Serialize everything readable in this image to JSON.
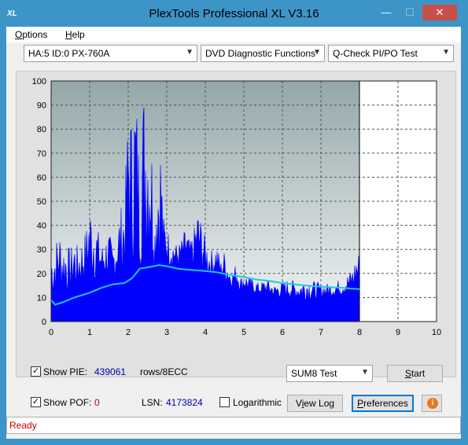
{
  "window": {
    "title": "PlexTools Professional XL V3.16",
    "icon_text": "XL",
    "min_symbol": "—",
    "max_symbol": "☐",
    "close_symbol": "✕",
    "accent": "#3d95c7"
  },
  "menu": {
    "options_first": "O",
    "options_rest": "ptions",
    "help_first": "H",
    "help_rest": "elp"
  },
  "toolbar": {
    "drive": "HA:5 ID:0  PX-760A",
    "function": "DVD Diagnostic Functions",
    "test": "Q-Check PI/PO Test"
  },
  "chart_data": {
    "type": "area",
    "x_ticks": [
      0,
      1,
      2,
      3,
      4,
      5,
      6,
      7,
      8,
      9,
      10
    ],
    "y_ticks": [
      0,
      10,
      20,
      30,
      40,
      50,
      60,
      70,
      80,
      90,
      100
    ],
    "xlim": [
      0,
      10
    ],
    "ylim": [
      0,
      100
    ],
    "grid": true,
    "data_end_x": 8,
    "fill_color": "#0000ff",
    "line_color": "#1ec8e8",
    "pie_envelope": {
      "x": [
        0,
        0.1,
        0.2,
        0.3,
        0.4,
        0.5,
        0.6,
        0.7,
        0.8,
        0.9,
        1.0,
        1.1,
        1.2,
        1.3,
        1.4,
        1.5,
        1.6,
        1.7,
        1.8,
        1.9,
        2.0,
        2.05,
        2.1,
        2.15,
        2.2,
        2.25,
        2.3,
        2.35,
        2.4,
        2.5,
        2.6,
        2.7,
        2.75,
        2.8,
        2.85,
        2.9,
        3.0,
        3.1,
        3.2,
        3.3,
        3.4,
        3.5,
        3.6,
        3.7,
        3.8,
        3.9,
        4.0,
        4.1,
        4.2,
        4.3,
        4.4,
        4.5,
        4.6,
        4.7,
        4.8,
        4.9,
        5.0,
        5.2,
        5.4,
        5.6,
        5.8,
        6.0,
        6.2,
        6.4,
        6.6,
        6.8,
        7.0,
        7.2,
        7.4,
        7.6,
        7.7,
        7.8,
        7.85,
        7.9,
        7.95,
        8.0
      ],
      "y": [
        30,
        32,
        40,
        33,
        33,
        30,
        35,
        31,
        35,
        38,
        50,
        45,
        40,
        32,
        35,
        38,
        30,
        37,
        48,
        50,
        90,
        95,
        80,
        98,
        99,
        85,
        60,
        85,
        100,
        90,
        80,
        40,
        70,
        65,
        80,
        45,
        40,
        35,
        33,
        32,
        35,
        40,
        33,
        38,
        48,
        42,
        35,
        30,
        30,
        33,
        25,
        30,
        22,
        20,
        25,
        18,
        20,
        18,
        16,
        18,
        15,
        17,
        18,
        16,
        18,
        17,
        16,
        16,
        17,
        18,
        20,
        22,
        24,
        28,
        30,
        29
      ]
    },
    "pie_floor": {
      "x": [
        0,
        0.5,
        1.0,
        1.5,
        2.0,
        2.5,
        3.0,
        3.5,
        4.0,
        4.5,
        5.0,
        5.5,
        6.0,
        6.5,
        7.0,
        7.5,
        8.0
      ],
      "y": [
        8,
        10,
        14,
        16,
        17,
        20,
        22,
        20,
        18,
        16,
        12,
        10,
        9,
        8,
        9,
        10,
        11
      ]
    },
    "pie_sum8_line": {
      "x": [
        0,
        0.1,
        0.3,
        0.6,
        1.0,
        1.3,
        1.6,
        1.9,
        2.1,
        2.3,
        2.5,
        2.8,
        3.0,
        3.3,
        3.6,
        4.0,
        4.3,
        4.6,
        5.0,
        5.3,
        5.6,
        6.0,
        6.3,
        6.6,
        7.0,
        7.3,
        7.6,
        7.8,
        8.0
      ],
      "y": [
        9,
        7,
        8,
        10,
        12,
        14,
        15.5,
        16,
        18,
        22,
        22.5,
        23.5,
        23,
        22,
        21.5,
        21,
        20.5,
        19.5,
        18.5,
        17.5,
        17,
        16,
        15.5,
        15,
        14.5,
        14.2,
        14,
        13.7,
        13.5
      ]
    }
  },
  "controls": {
    "show_pie_label": "Show PIE:",
    "show_pie_checked": "✓",
    "pie_value": "439061",
    "pie_units": "rows/8ECC",
    "show_poe_label": "Show POF:",
    "show_poe_checked": "✓",
    "poe_value": "0",
    "lsn_label": "LSN:",
    "lsn_value": "4173824",
    "logarithmic_label": "Logarithmic",
    "logarithmic_checked": "",
    "sum_select": "SUM8 Test",
    "start_first": "S",
    "start_rest": "tart",
    "view_log_prefix": "V",
    "view_log_mid": "i",
    "view_log_rest": "ew Log",
    "preferences_first": "P",
    "preferences_rest": "references",
    "info_symbol": "i"
  },
  "status": {
    "text": "Ready",
    "color": "#d00000"
  }
}
